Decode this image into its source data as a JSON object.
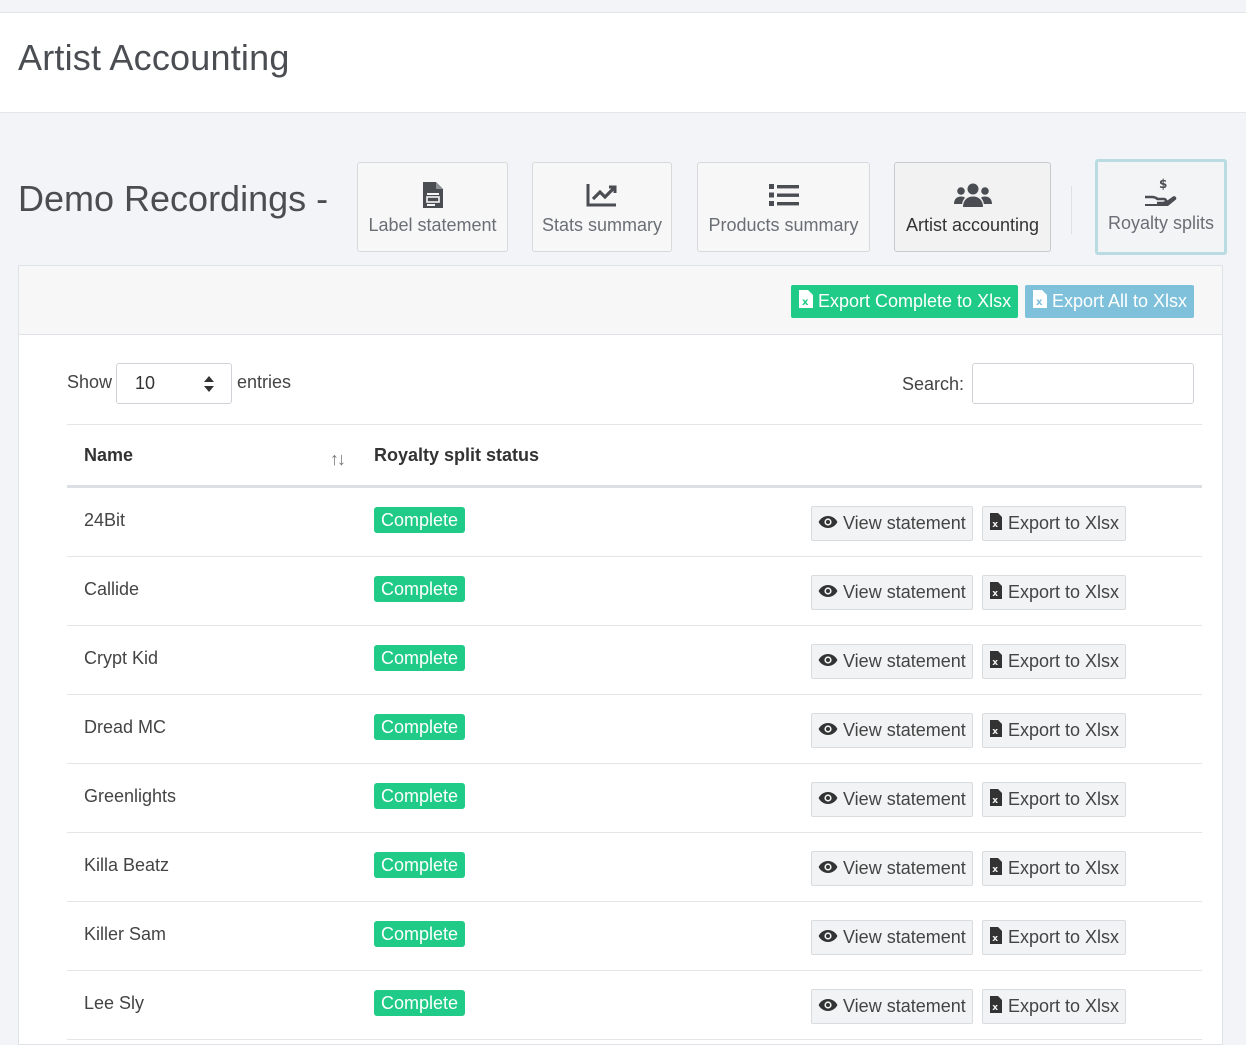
{
  "page": {
    "title": "Artist Accounting"
  },
  "label": {
    "title": "Demo Recordings -"
  },
  "nav": [
    {
      "id": "label-statement",
      "label": "Label statement",
      "icon": "file-invoice-icon"
    },
    {
      "id": "stats-summary",
      "label": "Stats summary",
      "icon": "chart-line-icon"
    },
    {
      "id": "products-summary",
      "label": "Products summary",
      "icon": "list-icon"
    },
    {
      "id": "artist-accounting",
      "label": "Artist accounting",
      "icon": "users-icon",
      "active": true
    },
    {
      "id": "royalty-splits",
      "label": "Royalty splits",
      "icon": "hand-dollar-icon"
    }
  ],
  "toolbar": {
    "export_complete": "Export Complete to Xlsx",
    "export_all": "Export All to Xlsx"
  },
  "controls": {
    "show_label": "Show",
    "entries_value": "10",
    "entries_label": "entries",
    "search_label": "Search:",
    "search_value": ""
  },
  "table": {
    "columns": [
      "Name",
      "Royalty split status"
    ],
    "rows": [
      {
        "name": "24Bit",
        "status": "Complete"
      },
      {
        "name": "Callide",
        "status": "Complete"
      },
      {
        "name": "Crypt Kid",
        "status": "Complete"
      },
      {
        "name": "Dread MC",
        "status": "Complete"
      },
      {
        "name": "Greenlights",
        "status": "Complete"
      },
      {
        "name": "Killa Beatz",
        "status": "Complete"
      },
      {
        "name": "Killer Sam",
        "status": "Complete"
      },
      {
        "name": "Lee Sly",
        "status": "Complete"
      }
    ],
    "actions": {
      "view": "View statement",
      "export": "Export to Xlsx"
    }
  },
  "colors": {
    "success": "#1fcb86",
    "info": "#7fc0db",
    "text": "#333333",
    "icon": "#4a4d52"
  }
}
